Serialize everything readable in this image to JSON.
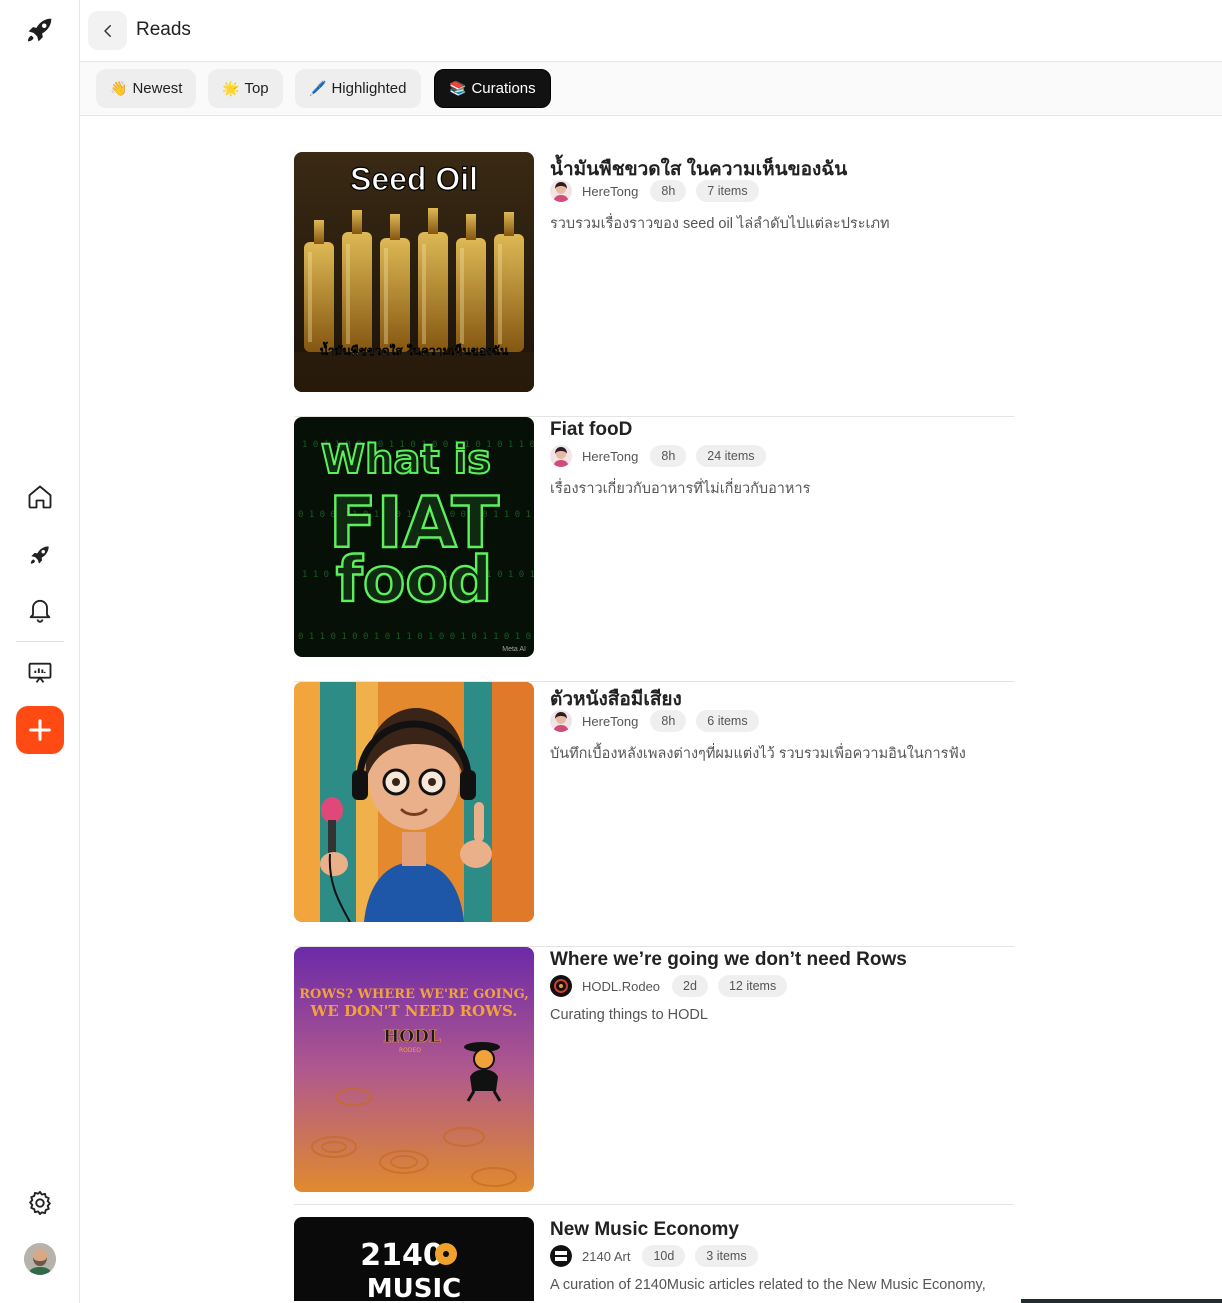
{
  "header": {
    "title": "Reads"
  },
  "tabs": [
    {
      "emoji": "👋",
      "label": "Newest",
      "active": false
    },
    {
      "emoji": "🌟",
      "label": "Top",
      "active": false
    },
    {
      "emoji": "🖊️",
      "label": "Highlighted",
      "active": false
    },
    {
      "emoji": "📚",
      "label": "Curations",
      "active": true
    }
  ],
  "sidebar": {
    "items": [
      {
        "name": "logo-rocket-icon"
      },
      {
        "name": "home-icon"
      },
      {
        "name": "rocket-icon"
      },
      {
        "name": "bell-icon"
      },
      {
        "name": "presentation-icon"
      },
      {
        "name": "plus-icon"
      },
      {
        "name": "gear-icon"
      },
      {
        "name": "avatar"
      }
    ]
  },
  "curations": [
    {
      "title": "น้ำมันพืชขวดใส ในความเห็นของฉัน",
      "author": "HereTong",
      "age": "8h",
      "items": "7 items",
      "description": "รวบรวมเรื่องราวของ seed oil ไล่ลำดับไปแต่ละประเภท",
      "thumb_text": "Seed Oil",
      "thumb_caption": "น้ำมันพืชขวดใส ในความเห็นของฉัน"
    },
    {
      "title": "Fiat fooD",
      "author": "HereTong",
      "age": "8h",
      "items": "24 items",
      "description": "เรื่องราวเกี่ยวกับอาหารที่ไม่เกี่ยวกับอาหาร",
      "thumb_text_1": "What is",
      "thumb_text_2": "FIAT",
      "thumb_text_3": "food",
      "thumb_caption": "Meta AI"
    },
    {
      "title": "ตัวหนังสือมีเสียง",
      "author": "HereTong",
      "age": "8h",
      "items": "6 items",
      "description": "บันทึกเบื้องหลังเพลงต่างๆที่ผมแต่งไว้ รวบรวมเพื่อความอินในการฟัง"
    },
    {
      "title": "Where we’re going we don’t need Rows",
      "author": "HODL.Rodeo",
      "age": "2d",
      "items": "12 items",
      "description": "Curating things to HODL",
      "thumb_text_1": "ROWS? WHERE WE'RE GOING,",
      "thumb_text_2": "WE DON'T NEED ROWS.",
      "thumb_text_3": "HODL",
      "thumb_text_4": "RODEO"
    },
    {
      "title": "New Music Economy",
      "author": "2140 Art",
      "age": "10d",
      "items": "3 items",
      "description": "A curation of 2140Music articles related to the New Music Economy,",
      "thumb_text_1": "2140",
      "thumb_text_2": "MUSIC"
    }
  ],
  "colors": {
    "accent": "#ff4a14",
    "active_tab": "#121212"
  }
}
